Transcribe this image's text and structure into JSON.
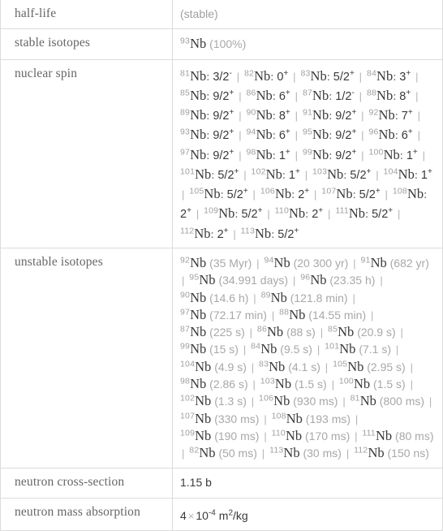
{
  "table": {
    "rows": [
      {
        "label": "half-life",
        "kind": "simple"
      },
      {
        "label": "stable isotopes",
        "kind": "isotopes"
      },
      {
        "label": "nuclear spin",
        "kind": "spins"
      },
      {
        "label": "unstable isotopes",
        "kind": "isotopes"
      },
      {
        "label": "neutron cross-section",
        "kind": "simple"
      },
      {
        "label": "neutron mass absorption",
        "kind": "simple"
      }
    ]
  },
  "half_life": {
    "label": "half-life",
    "value": "(stable)"
  },
  "stable_isotopes": {
    "label": "stable isotopes",
    "element": "Nb",
    "items": [
      {
        "mass": "93",
        "element": "Nb",
        "detail": "(100%)"
      }
    ]
  },
  "nuclear_spin": {
    "label": "nuclear spin",
    "element": "Nb",
    "separator": "|",
    "items": [
      {
        "mass": "81",
        "element": "Nb",
        "spin": "3/2",
        "sign": "-"
      },
      {
        "mass": "82",
        "element": "Nb",
        "spin": "0",
        "sign": "+"
      },
      {
        "mass": "83",
        "element": "Nb",
        "spin": "5/2",
        "sign": "+"
      },
      {
        "mass": "84",
        "element": "Nb",
        "spin": "3",
        "sign": "+"
      },
      {
        "mass": "85",
        "element": "Nb",
        "spin": "9/2",
        "sign": "+"
      },
      {
        "mass": "86",
        "element": "Nb",
        "spin": "6",
        "sign": "+"
      },
      {
        "mass": "87",
        "element": "Nb",
        "spin": "1/2",
        "sign": "-"
      },
      {
        "mass": "88",
        "element": "Nb",
        "spin": "8",
        "sign": "+"
      },
      {
        "mass": "89",
        "element": "Nb",
        "spin": "9/2",
        "sign": "+"
      },
      {
        "mass": "90",
        "element": "Nb",
        "spin": "8",
        "sign": "+"
      },
      {
        "mass": "91",
        "element": "Nb",
        "spin": "9/2",
        "sign": "+"
      },
      {
        "mass": "92",
        "element": "Nb",
        "spin": "7",
        "sign": "+"
      },
      {
        "mass": "93",
        "element": "Nb",
        "spin": "9/2",
        "sign": "+"
      },
      {
        "mass": "94",
        "element": "Nb",
        "spin": "6",
        "sign": "+"
      },
      {
        "mass": "95",
        "element": "Nb",
        "spin": "9/2",
        "sign": "+"
      },
      {
        "mass": "96",
        "element": "Nb",
        "spin": "6",
        "sign": "+"
      },
      {
        "mass": "97",
        "element": "Nb",
        "spin": "9/2",
        "sign": "+"
      },
      {
        "mass": "98",
        "element": "Nb",
        "spin": "1",
        "sign": "+"
      },
      {
        "mass": "99",
        "element": "Nb",
        "spin": "9/2",
        "sign": "+"
      },
      {
        "mass": "100",
        "element": "Nb",
        "spin": "1",
        "sign": "+"
      },
      {
        "mass": "101",
        "element": "Nb",
        "spin": "5/2",
        "sign": "+"
      },
      {
        "mass": "102",
        "element": "Nb",
        "spin": "1",
        "sign": "+"
      },
      {
        "mass": "103",
        "element": "Nb",
        "spin": "5/2",
        "sign": "+"
      },
      {
        "mass": "104",
        "element": "Nb",
        "spin": "1",
        "sign": "+"
      },
      {
        "mass": "105",
        "element": "Nb",
        "spin": "5/2",
        "sign": "+"
      },
      {
        "mass": "106",
        "element": "Nb",
        "spin": "2",
        "sign": "+"
      },
      {
        "mass": "107",
        "element": "Nb",
        "spin": "5/2",
        "sign": "+"
      },
      {
        "mass": "108",
        "element": "Nb",
        "spin": "2",
        "sign": "+"
      },
      {
        "mass": "109",
        "element": "Nb",
        "spin": "5/2",
        "sign": "+"
      },
      {
        "mass": "110",
        "element": "Nb",
        "spin": "2",
        "sign": "+"
      },
      {
        "mass": "111",
        "element": "Nb",
        "spin": "5/2",
        "sign": "+"
      },
      {
        "mass": "112",
        "element": "Nb",
        "spin": "2",
        "sign": "+"
      },
      {
        "mass": "113",
        "element": "Nb",
        "spin": "5/2",
        "sign": "+"
      }
    ]
  },
  "unstable_isotopes": {
    "label": "unstable isotopes",
    "element": "Nb",
    "separator": "|",
    "items": [
      {
        "mass": "92",
        "element": "Nb",
        "detail": "(35 Myr)"
      },
      {
        "mass": "94",
        "element": "Nb",
        "detail": "(20 300 yr)"
      },
      {
        "mass": "91",
        "element": "Nb",
        "detail": "(682 yr)"
      },
      {
        "mass": "95",
        "element": "Nb",
        "detail": "(34.991 days)"
      },
      {
        "mass": "96",
        "element": "Nb",
        "detail": "(23.35 h)"
      },
      {
        "mass": "90",
        "element": "Nb",
        "detail": "(14.6 h)"
      },
      {
        "mass": "89",
        "element": "Nb",
        "detail": "(121.8 min)"
      },
      {
        "mass": "97",
        "element": "Nb",
        "detail": "(72.17 min)"
      },
      {
        "mass": "88",
        "element": "Nb",
        "detail": "(14.55 min)"
      },
      {
        "mass": "87",
        "element": "Nb",
        "detail": "(225 s)"
      },
      {
        "mass": "86",
        "element": "Nb",
        "detail": "(88 s)"
      },
      {
        "mass": "85",
        "element": "Nb",
        "detail": "(20.9 s)"
      },
      {
        "mass": "99",
        "element": "Nb",
        "detail": "(15 s)"
      },
      {
        "mass": "84",
        "element": "Nb",
        "detail": "(9.5 s)"
      },
      {
        "mass": "101",
        "element": "Nb",
        "detail": "(7.1 s)"
      },
      {
        "mass": "104",
        "element": "Nb",
        "detail": "(4.9 s)"
      },
      {
        "mass": "83",
        "element": "Nb",
        "detail": "(4.1 s)"
      },
      {
        "mass": "105",
        "element": "Nb",
        "detail": "(2.95 s)"
      },
      {
        "mass": "98",
        "element": "Nb",
        "detail": "(2.86 s)"
      },
      {
        "mass": "103",
        "element": "Nb",
        "detail": "(1.5 s)"
      },
      {
        "mass": "100",
        "element": "Nb",
        "detail": "(1.5 s)"
      },
      {
        "mass": "102",
        "element": "Nb",
        "detail": "(1.3 s)"
      },
      {
        "mass": "106",
        "element": "Nb",
        "detail": "(930 ms)"
      },
      {
        "mass": "81",
        "element": "Nb",
        "detail": "(800 ms)"
      },
      {
        "mass": "107",
        "element": "Nb",
        "detail": "(330 ms)"
      },
      {
        "mass": "108",
        "element": "Nb",
        "detail": "(193 ms)"
      },
      {
        "mass": "109",
        "element": "Nb",
        "detail": "(190 ms)"
      },
      {
        "mass": "110",
        "element": "Nb",
        "detail": "(170 ms)"
      },
      {
        "mass": "111",
        "element": "Nb",
        "detail": "(80 ms)"
      },
      {
        "mass": "82",
        "element": "Nb",
        "detail": "(50 ms)"
      },
      {
        "mass": "113",
        "element": "Nb",
        "detail": "(30 ms)"
      },
      {
        "mass": "112",
        "element": "Nb",
        "detail": "(150 ns)"
      }
    ]
  },
  "neutron_cross_section": {
    "label": "neutron cross-section",
    "value": "1.15 b"
  },
  "neutron_mass_absorption": {
    "label": "neutron mass absorption",
    "coefficient": "4",
    "times": "×",
    "base": "10",
    "exponent": "-4",
    "unit_m": "m",
    "unit_m_exp": "2",
    "unit_tail": "/kg"
  },
  "colors": {
    "border": "#dcdcdc",
    "label_text": "#666666",
    "value_text": "#3a3a3a",
    "muted_text": "#a0a0a0",
    "separator": "#b4b4b4",
    "background": "#ffffff"
  }
}
